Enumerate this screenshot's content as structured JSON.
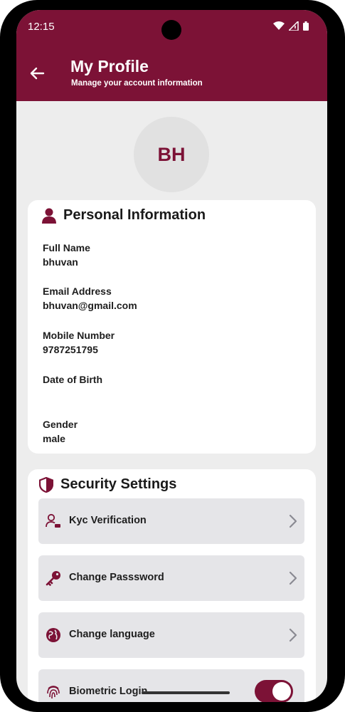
{
  "status_bar": {
    "time": "12:15"
  },
  "header": {
    "title": "My Profile",
    "subtitle": "Manage your account information"
  },
  "avatar": {
    "initials": "BH"
  },
  "personal_info": {
    "title": "Personal Information",
    "fields": [
      {
        "label": "Full Name",
        "value": "bhuvan"
      },
      {
        "label": "Email Address",
        "value": "bhuvan@gmail.com"
      },
      {
        "label": "Mobile Number",
        "value": "9787251795"
      },
      {
        "label": "Date of Birth",
        "value": ""
      },
      {
        "label": "Gender",
        "value": "male"
      }
    ]
  },
  "security": {
    "title": "Security Settings",
    "items": [
      {
        "label": "Kyc Verification",
        "icon": "kyc-user-icon"
      },
      {
        "label": "Change Passsword",
        "icon": "key-icon"
      },
      {
        "label": "Change language",
        "icon": "globe-icon"
      },
      {
        "label": "Biometric Login",
        "icon": "fingerprint-icon",
        "toggle_on": true
      }
    ]
  },
  "colors": {
    "primary": "#7c1236",
    "background": "#ededed",
    "item_bg": "#e5e5e8"
  }
}
